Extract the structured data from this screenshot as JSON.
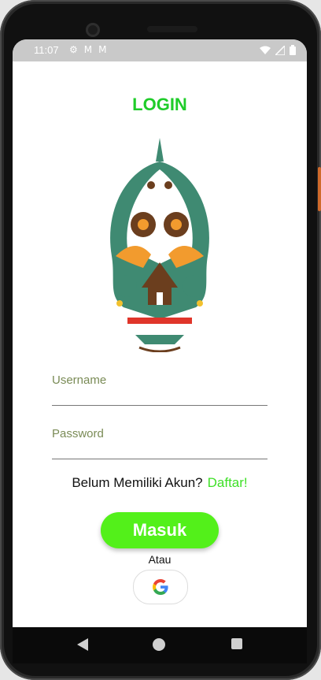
{
  "status": {
    "time": "11:07",
    "left_icons": [
      "gear-icon",
      "gmail-icon",
      "gmail-icon-2"
    ],
    "right_icons": [
      "wifi-icon",
      "signal-icon",
      "battery-icon"
    ]
  },
  "login": {
    "title": "LOGIN",
    "username_label": "Username",
    "password_label": "Password",
    "signup_prompt": "Belum Memiliki Akun?",
    "signup_link": "Daftar!",
    "submit_label": "Masuk",
    "alt_label": "Atau"
  },
  "icons": {
    "logo": "gunungan-wayang-logo-icon",
    "google": "google-icon"
  },
  "colors": {
    "title": "#1fcc2a",
    "button": "#53f01a",
    "link": "#3ee027"
  }
}
